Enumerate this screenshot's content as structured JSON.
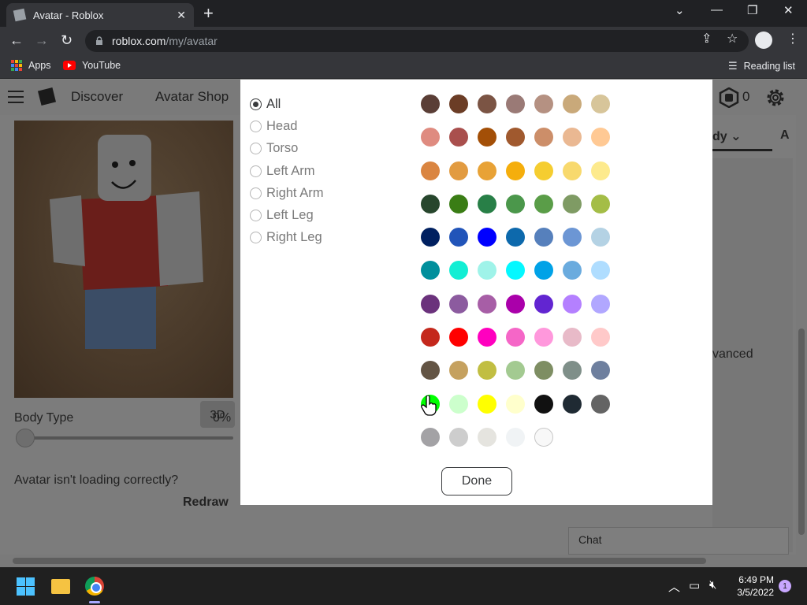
{
  "browser": {
    "tab_title": "Avatar - Roblox",
    "tab_close": "✕",
    "new_tab": "+",
    "url_host": "roblox.com",
    "url_path": "/my/avatar",
    "bookmarks": {
      "apps": "Apps",
      "youtube": "YouTube",
      "reading_list": "Reading list"
    }
  },
  "nav": {
    "discover": "Discover",
    "avatar_shop": "Avatar Shop",
    "robux_count": "0"
  },
  "preview": {
    "btn_3d": "3D"
  },
  "body_type": {
    "label": "Body Type",
    "value": "0%"
  },
  "loading": {
    "question": "Avatar isn't loading correctly?",
    "redraw": "Redraw"
  },
  "right_partial": {
    "tab_body": "dy ⌄",
    "tab_next": "A",
    "advanced": "vanced"
  },
  "chat": {
    "label": "Chat"
  },
  "modal": {
    "body_parts": [
      {
        "label": "All",
        "checked": true
      },
      {
        "label": "Head",
        "checked": false
      },
      {
        "label": "Torso",
        "checked": false
      },
      {
        "label": "Left Arm",
        "checked": false
      },
      {
        "label": "Right Arm",
        "checked": false
      },
      {
        "label": "Left Leg",
        "checked": false
      },
      {
        "label": "Right Leg",
        "checked": false
      }
    ],
    "colors": [
      "#5a3e36",
      "#6b3d26",
      "#7b5444",
      "#9a7a76",
      "#b59182",
      "#c9a97a",
      "#d7c59a",
      "#df8b80",
      "#a94f4d",
      "#a34f07",
      "#a0592e",
      "#cc8e69",
      "#eab892",
      "#ffc994",
      "#da8541",
      "#e29b40",
      "#e8a236",
      "#f5ae0c",
      "#f5cd30",
      "#f8d96d",
      "#fdea8d",
      "#27462d",
      "#3a7d15",
      "#287f47",
      "#4b974b",
      "#5a9d48",
      "#7f9b64",
      "#a4bd47",
      "#002060",
      "#2154b9",
      "#0000ff",
      "#0d69ac",
      "#5680bc",
      "#6c96d4",
      "#b4d2e4",
      "#008f9c",
      "#12eed4",
      "#9ff3e9",
      "#04f8ff",
      "#00a2e7",
      "#6aabde",
      "#afddff",
      "#6b327c",
      "#8c5b9f",
      "#a75ea6",
      "#aa00aa",
      "#6225d1",
      "#b480ff",
      "#b1a7ff",
      "#c4281c",
      "#ff0000",
      "#ff00bf",
      "#f566c7",
      "#ff98dc",
      "#e8bac8",
      "#ffc9c9",
      "#635444",
      "#c5a15f",
      "#c1be42",
      "#a3ca91",
      "#7e8e63",
      "#7f8f89",
      "#6e7f9e",
      "#00ff00",
      "#ccffcc",
      "#ffff00",
      "#ffffcc",
      "#111111",
      "#1f2a33",
      "#646464",
      "#a3a2a5",
      "#cdcdcd",
      "#e5e4df",
      "#f0f3f5",
      "#f8f8f8"
    ],
    "done_label": "Done"
  },
  "taskbar": {
    "time": "6:49 PM",
    "date": "3/5/2022",
    "notifications": "1"
  }
}
